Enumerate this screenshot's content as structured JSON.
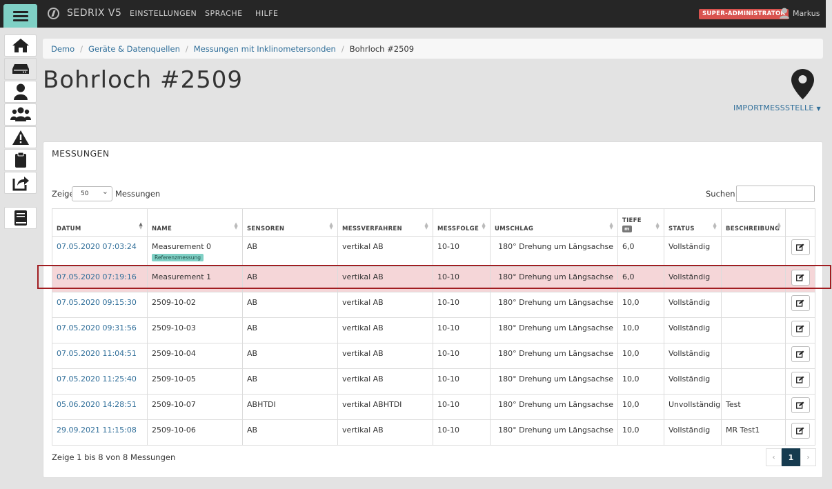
{
  "topbar": {
    "brand": "SEDRIX V5",
    "nav": [
      "EINSTELLUNGEN",
      "SPRACHE",
      "HILFE"
    ],
    "role": "SUPER-ADMINISTRATOR",
    "user": "Markus"
  },
  "sidebar": {
    "icons": [
      "home-icon",
      "server-icon",
      "user-icon",
      "users-icon",
      "warning-icon",
      "clipboard-icon",
      "share-icon",
      "book-icon"
    ],
    "active": "server-icon"
  },
  "breadcrumb": [
    "Demo",
    "Geräte & Datenquellen",
    "Messungen mit Inklinometersonden",
    "Bohrloch #2509"
  ],
  "page": {
    "title": "Bohrloch #2509",
    "import_label": "IMPORTMESSSTELLE"
  },
  "panel": {
    "title": "MESSUNGEN",
    "show_label": "Zeige",
    "page_length": "50",
    "show_suffix": "Messungen",
    "search_label": "Suchen:",
    "search_value": "",
    "columns": [
      "DATUM",
      "NAME",
      "SENSOREN",
      "MESSVERFAHREN",
      "MESSFOLGE",
      "UMSCHLAG",
      "TIEFE",
      "STATUS",
      "BESCHREIBUNG"
    ],
    "depth_unit": "m",
    "rows": [
      {
        "datum": "07.05.2020 07:03:24",
        "name": "Measurement 0",
        "badge": "Referenzmessung",
        "sensoren": "AB",
        "verfahren": "vertikal AB",
        "folge": "10-10",
        "umschlag": "180° Drehung um Längsachse",
        "tiefe": "6,0",
        "status": "Vollständig",
        "beschreibung": ""
      },
      {
        "datum": "07.05.2020 07:19:16",
        "name": "Measurement 1",
        "sensoren": "AB",
        "verfahren": "vertikal AB",
        "folge": "10-10",
        "umschlag": "180° Drehung um Längsachse",
        "tiefe": "6,0",
        "status": "Vollständig",
        "beschreibung": ""
      },
      {
        "datum": "07.05.2020 09:15:30",
        "name": "2509-10-02",
        "sensoren": "AB",
        "verfahren": "vertikal AB",
        "folge": "10-10",
        "umschlag": "180° Drehung um Längsachse",
        "tiefe": "10,0",
        "status": "Vollständig",
        "beschreibung": ""
      },
      {
        "datum": "07.05.2020 09:31:56",
        "name": "2509-10-03",
        "sensoren": "AB",
        "verfahren": "vertikal AB",
        "folge": "10-10",
        "umschlag": "180° Drehung um Längsachse",
        "tiefe": "10,0",
        "status": "Vollständig",
        "beschreibung": ""
      },
      {
        "datum": "07.05.2020 11:04:51",
        "name": "2509-10-04",
        "sensoren": "AB",
        "verfahren": "vertikal AB",
        "folge": "10-10",
        "umschlag": "180° Drehung um Längsachse",
        "tiefe": "10,0",
        "status": "Vollständig",
        "beschreibung": ""
      },
      {
        "datum": "07.05.2020 11:25:40",
        "name": "2509-10-05",
        "sensoren": "AB",
        "verfahren": "vertikal AB",
        "folge": "10-10",
        "umschlag": "180° Drehung um Längsachse",
        "tiefe": "10,0",
        "status": "Vollständig",
        "beschreibung": ""
      },
      {
        "datum": "05.06.2020 14:28:51",
        "name": "2509-10-07",
        "sensoren": "ABHTDI",
        "verfahren": "vertikal ABHTDI",
        "folge": "10-10",
        "umschlag": "180° Drehung um Längsachse",
        "tiefe": "10,0",
        "status": "Unvollständig",
        "beschreibung": "Test"
      },
      {
        "datum": "29.09.2021 11:15:08",
        "name": "2509-10-06",
        "sensoren": "AB",
        "verfahren": "vertikal AB",
        "folge": "10-10",
        "umschlag": "180° Drehung um Längsachse",
        "tiefe": "10,0",
        "status": "Vollständig",
        "beschreibung": "MR Test1"
      }
    ],
    "info": "Zeige 1 bis 8 von 8 Messungen",
    "pager": {
      "prev": "‹",
      "current": "1",
      "next": "›"
    }
  },
  "colors": {
    "accent": "#7fd0c5",
    "link": "#2f6e99",
    "highlight": "#a11d21",
    "badge_red": "#d9534f"
  }
}
